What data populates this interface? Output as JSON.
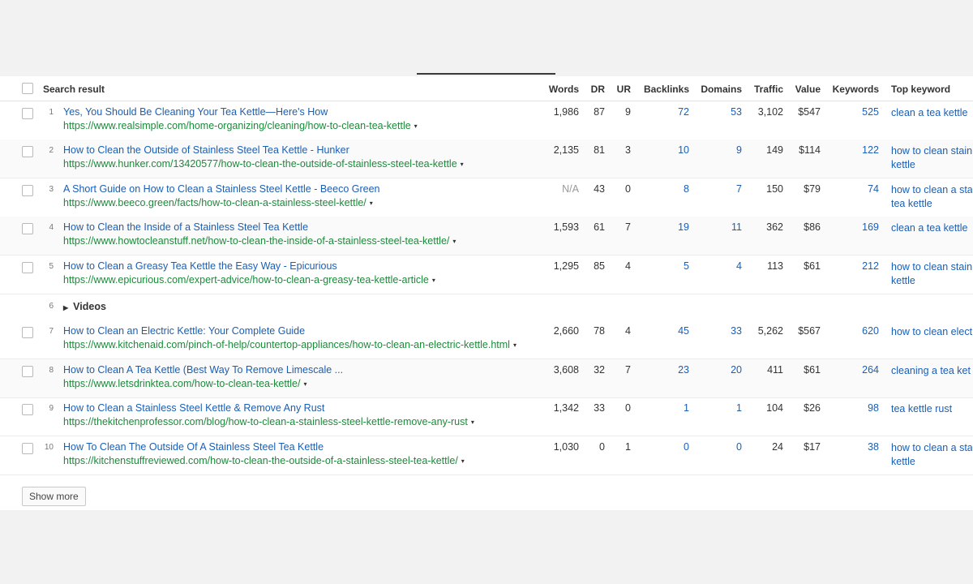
{
  "table": {
    "headers": {
      "search_result": "Search result",
      "words": "Words",
      "dr": "DR",
      "ur": "UR",
      "backlinks": "Backlinks",
      "domains": "Domains",
      "traffic": "Traffic",
      "value": "Value",
      "keywords": "Keywords",
      "top_keyword": "Top keyword"
    },
    "rows": [
      {
        "num": "1",
        "title": "Yes, You Should Be Cleaning Your Tea Kettle—Here's How",
        "url": "https://www.realsimple.com/home-organizing/cleaning/how-to-clean-tea-kettle",
        "words": "1,986",
        "dr": "87",
        "ur": "9",
        "backlinks": "72",
        "domains": "53",
        "traffic": "3,102",
        "value": "$547",
        "keywords": "525",
        "top_keyword_l1": "clean a tea kettle",
        "top_keyword_l2": ""
      },
      {
        "num": "2",
        "title": "How to Clean the Outside of Stainless Steel Tea Kettle - Hunker",
        "url": "https://www.hunker.com/13420577/how-to-clean-the-outside-of-stainless-steel-tea-kettle",
        "words": "2,135",
        "dr": "81",
        "ur": "3",
        "backlinks": "10",
        "domains": "9",
        "traffic": "149",
        "value": "$114",
        "keywords": "122",
        "top_keyword_l1": "how to clean stain",
        "top_keyword_l2": "kettle"
      },
      {
        "num": "3",
        "title": "A Short Guide on How to Clean a Stainless Steel Kettle - Beeco Green",
        "url": "https://www.beeco.green/facts/how-to-clean-a-stainless-steel-kettle/",
        "words": "N/A",
        "dr": "43",
        "ur": "0",
        "backlinks": "8",
        "domains": "7",
        "traffic": "150",
        "value": "$79",
        "keywords": "74",
        "top_keyword_l1": "how to clean a sta",
        "top_keyword_l2": "tea kettle"
      },
      {
        "num": "4",
        "title": "How to Clean the Inside of a Stainless Steel Tea Kettle",
        "url": "https://www.howtocleanstuff.net/how-to-clean-the-inside-of-a-stainless-steel-tea-kettle/",
        "words": "1,593",
        "dr": "61",
        "ur": "7",
        "backlinks": "19",
        "domains": "11",
        "traffic": "362",
        "value": "$86",
        "keywords": "169",
        "top_keyword_l1": "clean a tea kettle",
        "top_keyword_l2": ""
      },
      {
        "num": "5",
        "title": "How to Clean a Greasy Tea Kettle the Easy Way - Epicurious",
        "url": "https://www.epicurious.com/expert-advice/how-to-clean-a-greasy-tea-kettle-article",
        "words": "1,295",
        "dr": "85",
        "ur": "4",
        "backlinks": "5",
        "domains": "4",
        "traffic": "113",
        "value": "$61",
        "keywords": "212",
        "top_keyword_l1": "how to clean stain",
        "top_keyword_l2": "kettle"
      },
      {
        "num": "7",
        "title": "How to Clean an Electric Kettle: Your Complete Guide",
        "url": "https://www.kitchenaid.com/pinch-of-help/countertop-appliances/how-to-clean-an-electric-kettle.html",
        "words": "2,660",
        "dr": "78",
        "ur": "4",
        "backlinks": "45",
        "domains": "33",
        "traffic": "5,262",
        "value": "$567",
        "keywords": "620",
        "top_keyword_l1": "how to clean elect",
        "top_keyword_l2": ""
      },
      {
        "num": "8",
        "title": "How to Clean A Tea Kettle (Best Way To Remove Limescale ...",
        "url": "https://www.letsdrinktea.com/how-to-clean-tea-kettle/",
        "words": "3,608",
        "dr": "32",
        "ur": "7",
        "backlinks": "23",
        "domains": "20",
        "traffic": "411",
        "value": "$61",
        "keywords": "264",
        "top_keyword_l1": "cleaning a tea ket",
        "top_keyword_l2": ""
      },
      {
        "num": "9",
        "title": "How to Clean a Stainless Steel Kettle & Remove Any Rust",
        "url": "https://thekitchenprofessor.com/blog/how-to-clean-a-stainless-steel-kettle-remove-any-rust",
        "words": "1,342",
        "dr": "33",
        "ur": "0",
        "backlinks": "1",
        "domains": "1",
        "traffic": "104",
        "value": "$26",
        "keywords": "98",
        "top_keyword_l1": "tea kettle rust",
        "top_keyword_l2": ""
      },
      {
        "num": "10",
        "title": "How To Clean The Outside Of A Stainless Steel Tea Kettle",
        "url": "https://kitchenstuffreviewed.com/how-to-clean-the-outside-of-a-stainless-steel-tea-kettle/",
        "words": "1,030",
        "dr": "0",
        "ur": "1",
        "backlinks": "0",
        "domains": "0",
        "traffic": "24",
        "value": "$17",
        "keywords": "38",
        "top_keyword_l1": "how to clean a sta",
        "top_keyword_l2": "kettle"
      }
    ],
    "videos_row": {
      "num": "6",
      "label": "Videos"
    }
  },
  "show_more_label": "Show more",
  "icons": {
    "dropdown_caret": "caret-down-icon",
    "expand": "triangle-right-icon"
  },
  "colors": {
    "link": "#1a5fb4",
    "url": "#1c8a3a"
  }
}
